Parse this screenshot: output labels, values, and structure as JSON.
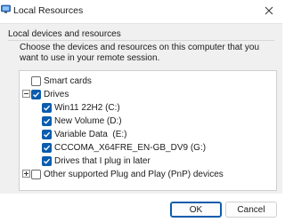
{
  "window": {
    "title": "Local Resources",
    "close_glyph": "✕"
  },
  "group": {
    "label": "Local devices and resources",
    "description": "Choose the devices and resources on this computer that you want to use in your remote session."
  },
  "tree": {
    "smart_cards": {
      "label": "Smart cards",
      "checked": false
    },
    "drives": {
      "label": "Drives",
      "checked": true,
      "expanded": true,
      "children": [
        {
          "label": "Win11 22H2 (C:)",
          "checked": true
        },
        {
          "label": "New Volume (D:)",
          "checked": true
        },
        {
          "label": "Variable Data  (E:)",
          "checked": true
        },
        {
          "label": "CCCOMA_X64FRE_EN-GB_DV9 (G:)",
          "checked": true
        },
        {
          "label": "Drives that I plug in later",
          "checked": true
        }
      ]
    },
    "other": {
      "label": "Other supported Plug and Play (PnP) devices",
      "checked": false,
      "expanded": false
    }
  },
  "buttons": {
    "ok": "OK",
    "cancel": "Cancel"
  },
  "colors": {
    "accent": "#0b5cad"
  },
  "icons": {
    "app": "remote-desktop-icon",
    "close": "close-icon",
    "check": "checkmark-icon"
  }
}
